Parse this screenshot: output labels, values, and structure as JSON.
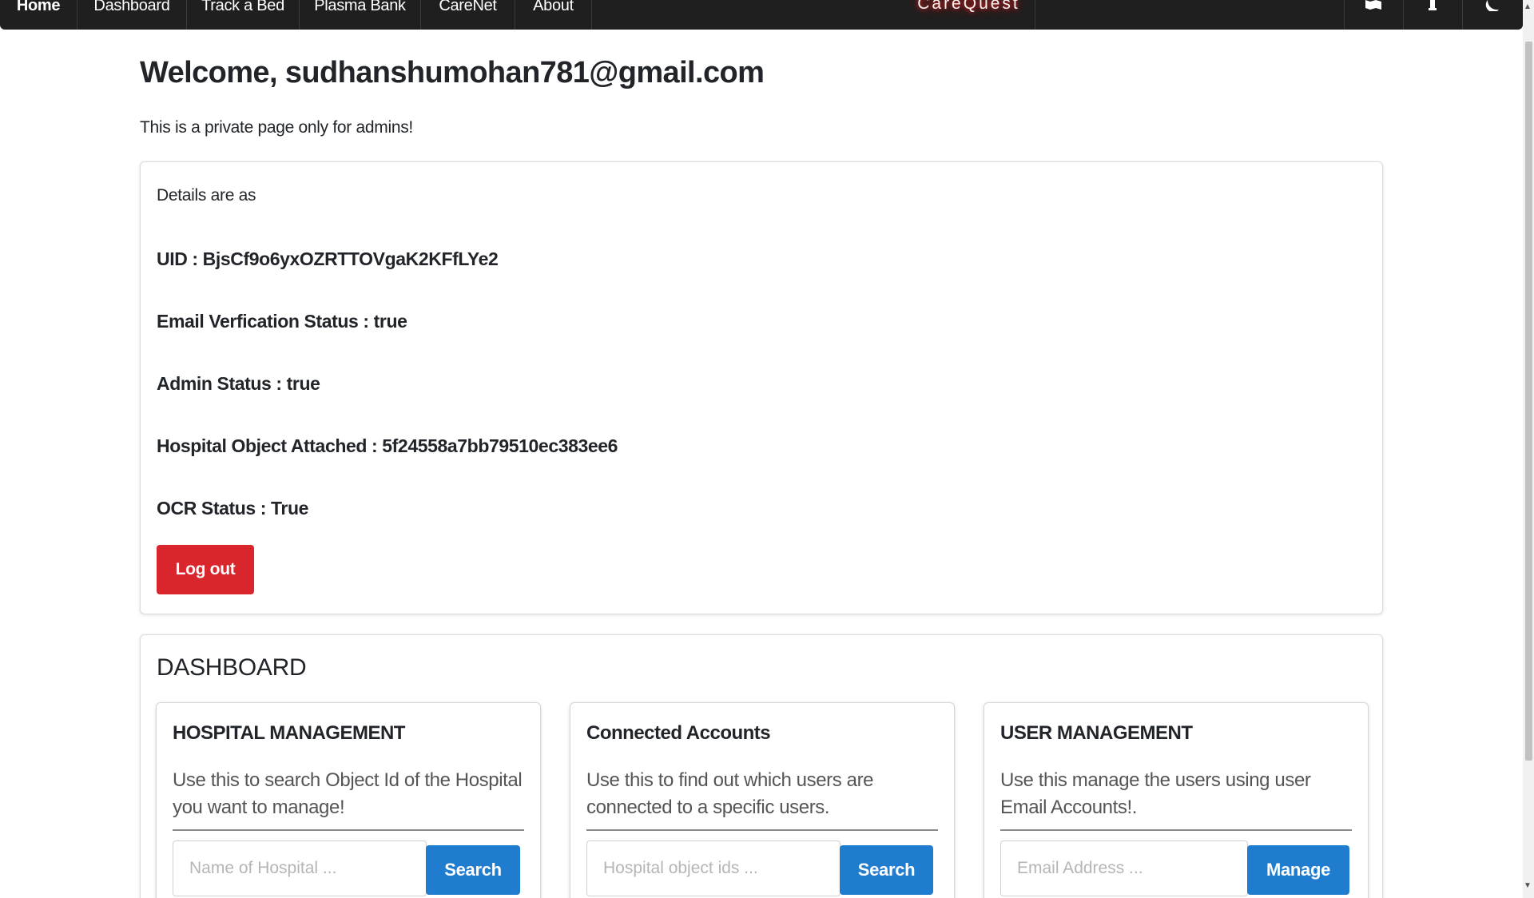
{
  "navbar": {
    "links": [
      {
        "label": "Home",
        "active": true
      },
      {
        "label": "Dashboard"
      },
      {
        "label": "Track a Bed"
      },
      {
        "label": "Plasma Bank"
      },
      {
        "label": "CareNet"
      },
      {
        "label": "About"
      }
    ],
    "brand": "CareQuest",
    "icons": [
      "map-icon",
      "info-icon",
      "moon-icon"
    ]
  },
  "page": {
    "welcome": "Welcome, sudhanshumohan781@gmail.com",
    "subtitle": "This is a private page only for admins!"
  },
  "details": {
    "intro": "Details are as",
    "rows": [
      {
        "label": "UID : ",
        "value": "BjsCf9o6yxOZRTTOVgaK2KFfLYe2"
      },
      {
        "label": "Email Verfication Status : ",
        "value": "true"
      },
      {
        "label": "Admin Status : ",
        "value": "true"
      },
      {
        "label": "Hospital Object Attached : ",
        "value": "5f24558a7bb79510ec383ee6"
      },
      {
        "label": "OCR Status : ",
        "value": "True"
      }
    ],
    "logout_label": "Log out"
  },
  "dashboard": {
    "title": "DASHBOARD",
    "cards": [
      {
        "title": "HOSPITAL MANAGEMENT",
        "description": "Use this to search Object Id of the Hospital you want to manage!",
        "placeholder": "Name of Hospital ...",
        "button": "Search"
      },
      {
        "title": "Connected Accounts",
        "description": "Use this to find out which users are connected to a specific users.",
        "placeholder": "Hospital object ids ...",
        "button": "Search"
      },
      {
        "title": "USER MANAGEMENT",
        "description": "Use this manage the users using user Email Accounts!.",
        "placeholder": "Email Address ...",
        "button": "Manage"
      }
    ]
  },
  "colors": {
    "navbar": "#1f1f1f",
    "logout": "#d9262c",
    "primary_button": "#1f7ccf",
    "brand_glow": "#ff2d2d"
  }
}
